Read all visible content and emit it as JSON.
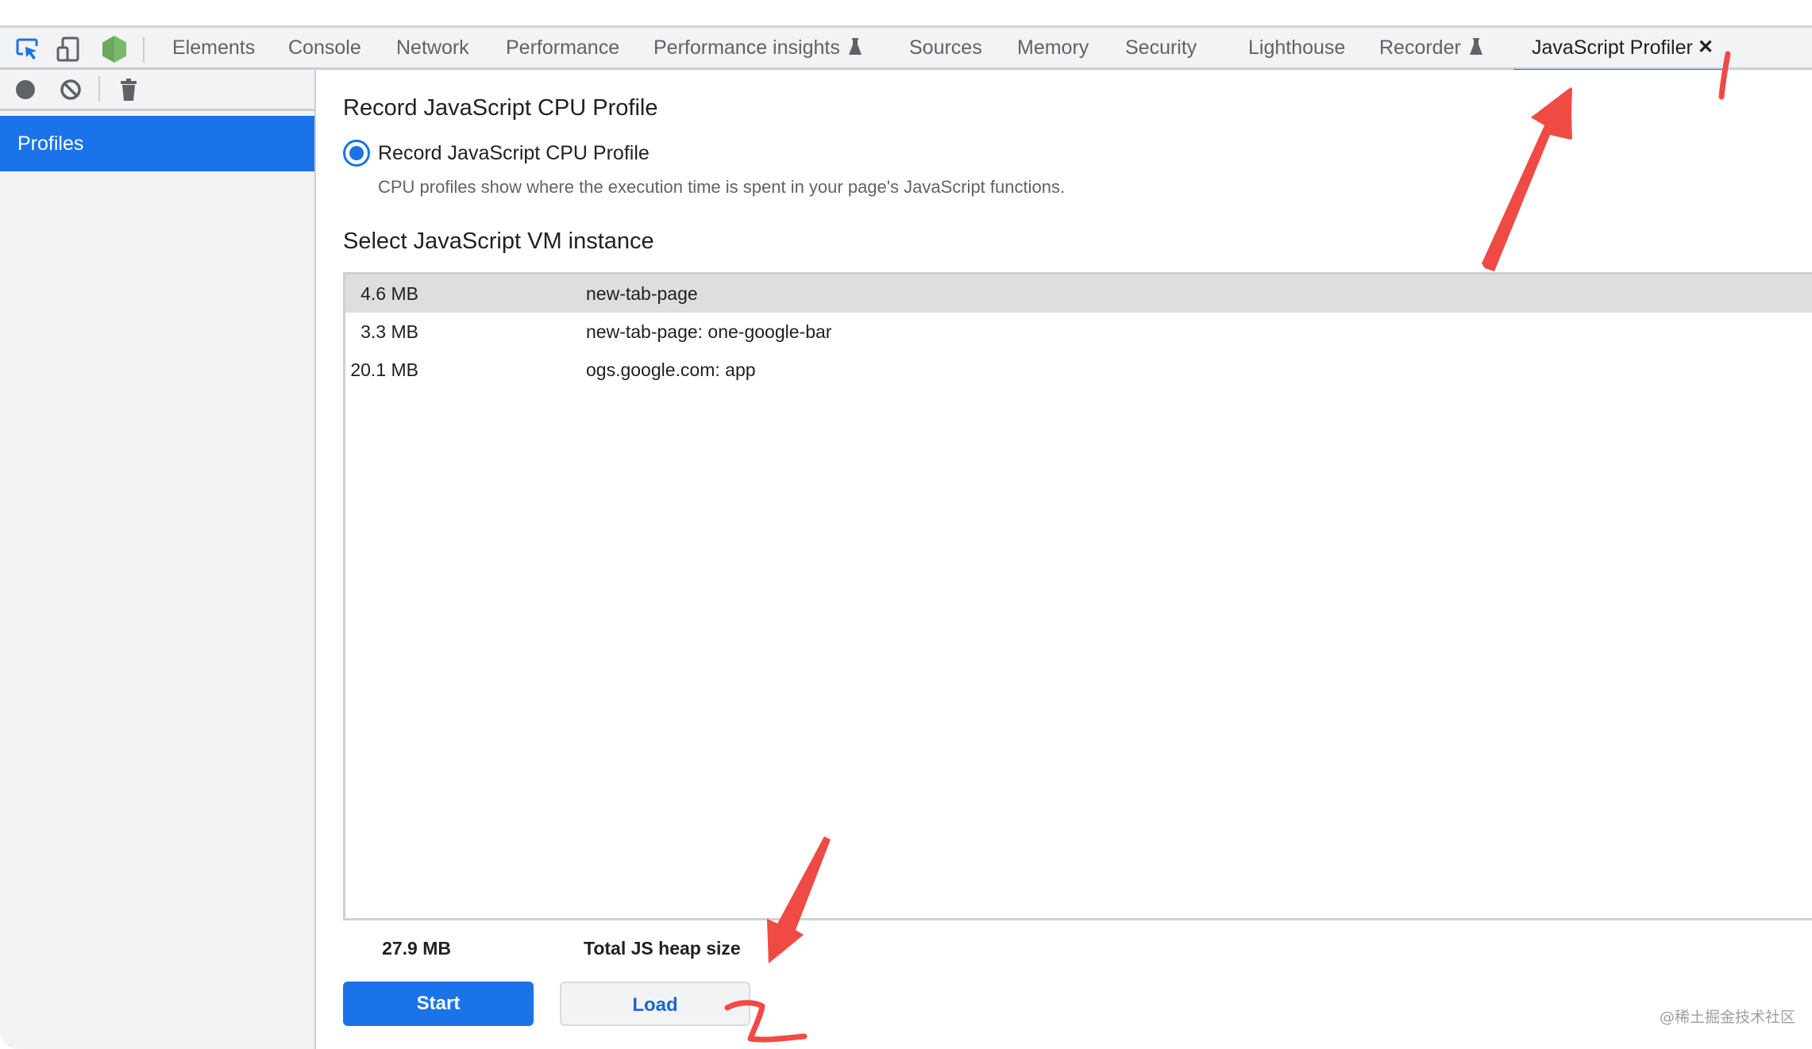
{
  "tabbar": {
    "tabs": [
      {
        "label": "Elements",
        "experimental": false
      },
      {
        "label": "Console",
        "experimental": false
      },
      {
        "label": "Network",
        "experimental": false
      },
      {
        "label": "Performance",
        "experimental": false
      },
      {
        "label": "Performance insights",
        "experimental": true
      },
      {
        "label": "Sources",
        "experimental": false
      },
      {
        "label": "Memory",
        "experimental": false
      },
      {
        "label": "Security",
        "experimental": false
      },
      {
        "label": "Lighthouse",
        "experimental": false
      },
      {
        "label": "Recorder",
        "experimental": true
      },
      {
        "label": "JavaScript Profiler",
        "experimental": false,
        "active": true,
        "closable": true
      }
    ],
    "close_glyph": "✕",
    "icons": [
      "inspect-element-icon",
      "device-toolbar-icon",
      "node-js-icon"
    ]
  },
  "sidebar": {
    "toolbar": [
      "record-icon",
      "clear-icon",
      "delete-icon"
    ],
    "items": [
      {
        "label": "Profiles",
        "selected": true
      }
    ]
  },
  "main": {
    "title": "Record JavaScript CPU Profile",
    "profile_type": {
      "label": "Record JavaScript CPU Profile",
      "selected": true,
      "description": "CPU profiles show where the execution time is spent in your page's JavaScript functions."
    },
    "vm_section_title": "Select JavaScript VM instance",
    "vm_instances": [
      {
        "size": "4.6 MB",
        "name": "new-tab-page",
        "selected": true
      },
      {
        "size": "3.3 MB",
        "name": "new-tab-page: one-google-bar",
        "selected": false
      },
      {
        "size": "20.1 MB",
        "name": "ogs.google.com: app",
        "selected": false
      }
    ],
    "total": {
      "size": "27.9 MB",
      "label": "Total JS heap size"
    },
    "buttons": {
      "start": "Start",
      "load": "Load"
    }
  },
  "annotations": {
    "arrow_1_label": "1",
    "arrow_2_label": "2",
    "color": "#f04a45"
  },
  "watermark": "@稀土掘金技术社区",
  "colors": {
    "accent": "#1a73e8",
    "toolbar_bg": "#f1f3f4",
    "selected_row": "#dedede"
  }
}
